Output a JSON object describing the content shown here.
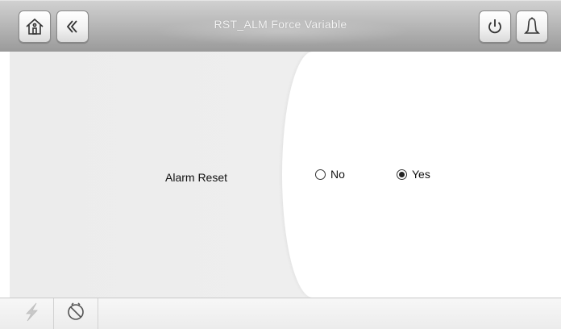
{
  "header": {
    "title": "RST_ALM Force Variable",
    "icons": [
      "home-icon",
      "back-icon",
      "power-icon",
      "alarm-bell-icon"
    ]
  },
  "form": {
    "field_label": "Alarm Reset",
    "options": [
      {
        "label": "No",
        "selected": false
      },
      {
        "label": "Yes",
        "selected": true
      }
    ]
  },
  "footer": {
    "icons": [
      "lightning-icon",
      "no-schedule-icon"
    ]
  },
  "colors": {
    "header_bg": "#b9b9b9",
    "title_text": "#f4f4f4",
    "panel_bg": "#ededed"
  }
}
